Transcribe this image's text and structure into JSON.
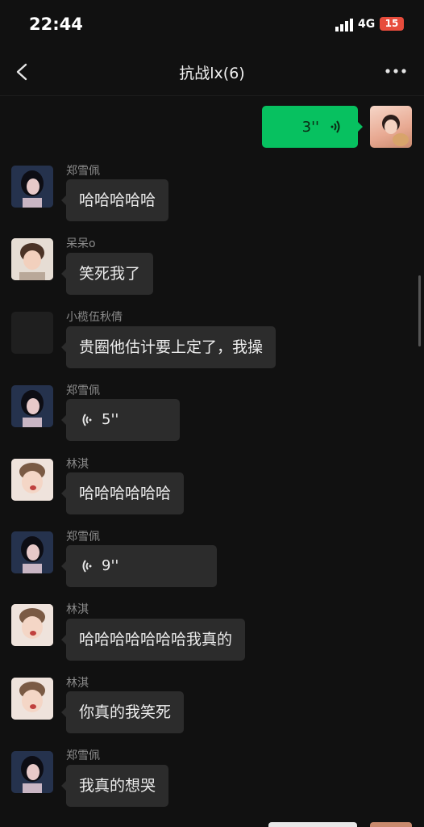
{
  "status": {
    "time": "22:44",
    "network": "4G",
    "battery": "15"
  },
  "header": {
    "title": "抗战lx(6)"
  },
  "self_voice": {
    "duration": "3''"
  },
  "messages": [
    {
      "name": "郑雪佩",
      "text": "哈哈哈哈哈"
    },
    {
      "name": "呆呆o",
      "text": "笑死我了"
    },
    {
      "name": "小榄伍秋倩",
      "text": "贵圈他估计要上定了，我操"
    },
    {
      "name": "郑雪佩",
      "voice": "5''"
    },
    {
      "name": "林淇",
      "text": "哈哈哈哈哈哈"
    },
    {
      "name": "郑雪佩",
      "voice": "9''"
    },
    {
      "name": "林淇",
      "text": "哈哈哈哈哈哈哈我真的"
    },
    {
      "name": "林淇",
      "text": "你真的我笑死"
    },
    {
      "name": "郑雪佩",
      "text": "我真的想哭"
    }
  ],
  "colors": {
    "background": "#111111",
    "bubble": "#2c2c2c",
    "self_bubble": "#07c160",
    "battery": "#e74c3c"
  }
}
